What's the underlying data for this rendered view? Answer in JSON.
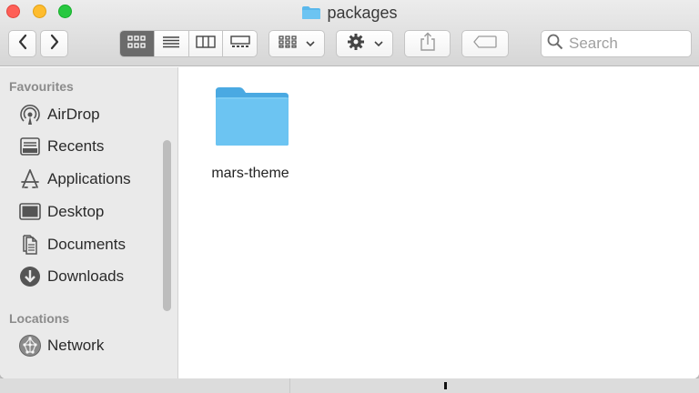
{
  "window": {
    "title": "packages"
  },
  "toolbar": {
    "back_icon": "chevron-left-icon",
    "forward_icon": "chevron-right-icon",
    "view_modes": [
      "icon-view",
      "list-view",
      "column-view",
      "gallery-view"
    ],
    "active_view": "icon-view",
    "group_icon": "group-by-icon",
    "action_icon": "gear-icon",
    "share_icon": "share-icon",
    "tag_icon": "tag-icon"
  },
  "search": {
    "placeholder": "Search"
  },
  "sidebar": {
    "favourites_title": "Favourites",
    "favourites": [
      {
        "label": "AirDrop",
        "icon": "airdrop-icon"
      },
      {
        "label": "Recents",
        "icon": "recents-icon"
      },
      {
        "label": "Applications",
        "icon": "applications-icon"
      },
      {
        "label": "Desktop",
        "icon": "desktop-icon"
      },
      {
        "label": "Documents",
        "icon": "documents-icon"
      },
      {
        "label": "Downloads",
        "icon": "downloads-icon"
      }
    ],
    "locations_title": "Locations",
    "locations": [
      {
        "label": "Network",
        "icon": "network-icon"
      }
    ]
  },
  "content": {
    "items": [
      {
        "name": "mars-theme",
        "icon": "folder-icon"
      }
    ]
  },
  "colors": {
    "folder": "#5ab8ec",
    "close": "#fe5f57",
    "minimize": "#febc2e",
    "maximize": "#28c840"
  }
}
